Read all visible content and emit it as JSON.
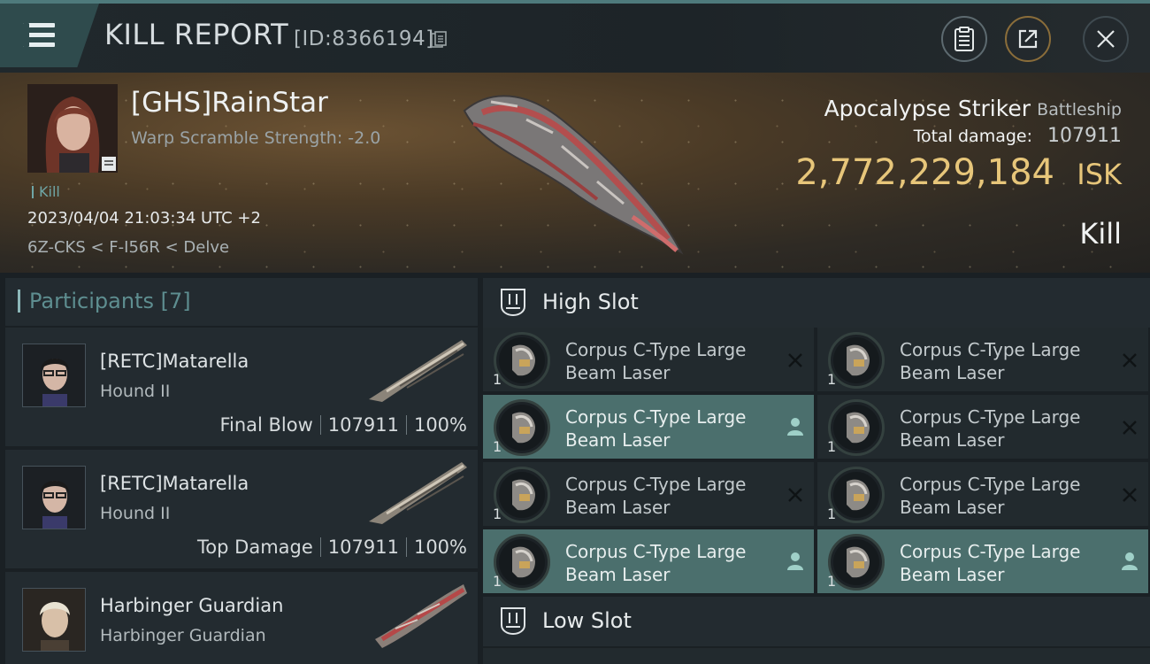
{
  "header": {
    "title": "KILL REPORT",
    "id_text": "[ID:8366194]",
    "icons": [
      "hamburger-menu-icon",
      "copy-icon",
      "clipboard-icon",
      "share-icon",
      "close-icon"
    ]
  },
  "victim": {
    "name": "[GHS]RainStar",
    "warp_scramble": "Warp Scramble Strength: -2.0",
    "tag": "Kill",
    "datetime": "2023/04/04 21:03:34 UTC +2",
    "location": "6Z-CKS < F-I56R < Delve",
    "ship_name": "Apocalypse Striker",
    "ship_class": "Battleship",
    "total_damage_label": "Total damage:",
    "total_damage": "107911",
    "isk_value": "2,772,229,184",
    "isk_unit": "ISK",
    "result": "Kill"
  },
  "participants": {
    "header": "Participants [7]",
    "items": [
      {
        "name": "[RETC]Matarella",
        "ship": "Hound II",
        "role": "Final Blow",
        "damage": "107911",
        "percent": "100%"
      },
      {
        "name": "[RETC]Matarella",
        "ship": "Hound II",
        "role": "Top Damage",
        "damage": "107911",
        "percent": "100%"
      },
      {
        "name": "Harbinger Guardian",
        "ship": "Harbinger Guardian",
        "role": "",
        "damage": "",
        "percent": ""
      }
    ]
  },
  "slots": {
    "high": {
      "title": "High Slot",
      "items": [
        {
          "name_line1": "Corpus C-Type Large",
          "name_line2": "Beam Laser",
          "qty": "1",
          "status": "destroyed"
        },
        {
          "name_line1": "Corpus C-Type Large",
          "name_line2": "Beam Laser",
          "qty": "1",
          "status": "destroyed"
        },
        {
          "name_line1": "Corpus C-Type Large",
          "name_line2": "Beam Laser",
          "qty": "1",
          "status": "dropped"
        },
        {
          "name_line1": "Corpus C-Type Large",
          "name_line2": "Beam Laser",
          "qty": "1",
          "status": "destroyed"
        },
        {
          "name_line1": "Corpus C-Type Large",
          "name_line2": "Beam Laser",
          "qty": "1",
          "status": "destroyed"
        },
        {
          "name_line1": "Corpus C-Type Large",
          "name_line2": "Beam Laser",
          "qty": "1",
          "status": "destroyed"
        },
        {
          "name_line1": "Corpus C-Type Large",
          "name_line2": "Beam Laser",
          "qty": "1",
          "status": "dropped"
        },
        {
          "name_line1": "Corpus C-Type Large",
          "name_line2": "Beam Laser",
          "qty": "1",
          "status": "dropped"
        }
      ]
    },
    "low": {
      "title": "Low Slot"
    }
  },
  "colors": {
    "accent": "#4b6f6d",
    "isk": "#e7c67a",
    "participants_title": "#5e8e90"
  }
}
